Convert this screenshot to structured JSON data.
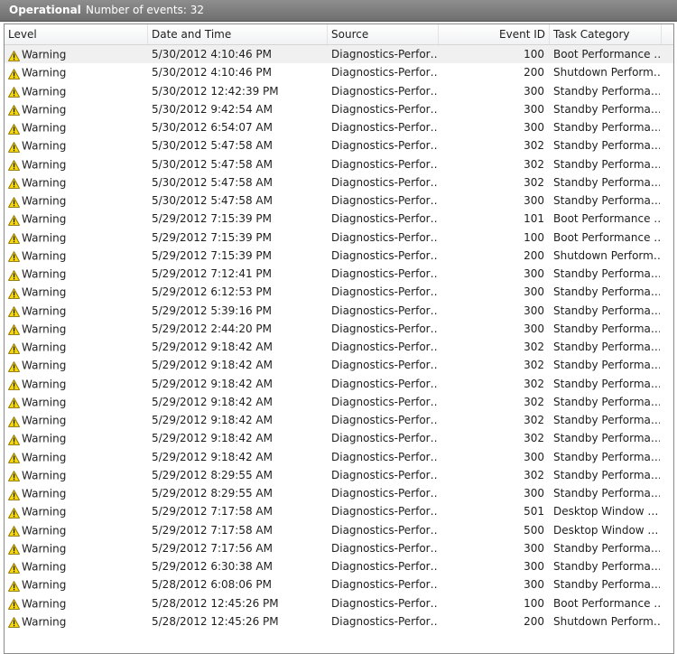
{
  "window": {
    "title": "Operational",
    "event_count_label": "Number of events: 32"
  },
  "columns": {
    "level": "Level",
    "date_time": "Date and Time",
    "source": "Source",
    "event_id": "Event ID",
    "task_category": "Task Category"
  },
  "icons": {
    "level": "warning-icon"
  },
  "colors": {
    "warning_fill": "#f5d90a",
    "warning_stroke": "#8a6d00",
    "titlebar": "#7a7a7a"
  },
  "events": [
    {
      "level": "Warning",
      "date": "5/30/2012 4:10:46 PM",
      "source": "Diagnostics-Perfor…",
      "id": "100",
      "category": "Boot Performance …"
    },
    {
      "level": "Warning",
      "date": "5/30/2012 4:10:46 PM",
      "source": "Diagnostics-Perfor…",
      "id": "200",
      "category": "Shutdown Perform…"
    },
    {
      "level": "Warning",
      "date": "5/30/2012 12:42:39 PM",
      "source": "Diagnostics-Perfor…",
      "id": "300",
      "category": "Standby Performa…"
    },
    {
      "level": "Warning",
      "date": "5/30/2012 9:42:54 AM",
      "source": "Diagnostics-Perfor…",
      "id": "300",
      "category": "Standby Performa…"
    },
    {
      "level": "Warning",
      "date": "5/30/2012 6:54:07 AM",
      "source": "Diagnostics-Perfor…",
      "id": "300",
      "category": "Standby Performa…"
    },
    {
      "level": "Warning",
      "date": "5/30/2012 5:47:58 AM",
      "source": "Diagnostics-Perfor…",
      "id": "302",
      "category": "Standby Performa…"
    },
    {
      "level": "Warning",
      "date": "5/30/2012 5:47:58 AM",
      "source": "Diagnostics-Perfor…",
      "id": "302",
      "category": "Standby Performa…"
    },
    {
      "level": "Warning",
      "date": "5/30/2012 5:47:58 AM",
      "source": "Diagnostics-Perfor…",
      "id": "302",
      "category": "Standby Performa…"
    },
    {
      "level": "Warning",
      "date": "5/30/2012 5:47:58 AM",
      "source": "Diagnostics-Perfor…",
      "id": "300",
      "category": "Standby Performa…"
    },
    {
      "level": "Warning",
      "date": "5/29/2012 7:15:39 PM",
      "source": "Diagnostics-Perfor…",
      "id": "101",
      "category": "Boot Performance …"
    },
    {
      "level": "Warning",
      "date": "5/29/2012 7:15:39 PM",
      "source": "Diagnostics-Perfor…",
      "id": "100",
      "category": "Boot Performance …"
    },
    {
      "level": "Warning",
      "date": "5/29/2012 7:15:39 PM",
      "source": "Diagnostics-Perfor…",
      "id": "200",
      "category": "Shutdown Perform…"
    },
    {
      "level": "Warning",
      "date": "5/29/2012 7:12:41 PM",
      "source": "Diagnostics-Perfor…",
      "id": "300",
      "category": "Standby Performa…"
    },
    {
      "level": "Warning",
      "date": "5/29/2012 6:12:53 PM",
      "source": "Diagnostics-Perfor…",
      "id": "300",
      "category": "Standby Performa…"
    },
    {
      "level": "Warning",
      "date": "5/29/2012 5:39:16 PM",
      "source": "Diagnostics-Perfor…",
      "id": "300",
      "category": "Standby Performa…"
    },
    {
      "level": "Warning",
      "date": "5/29/2012 2:44:20 PM",
      "source": "Diagnostics-Perfor…",
      "id": "300",
      "category": "Standby Performa…"
    },
    {
      "level": "Warning",
      "date": "5/29/2012 9:18:42 AM",
      "source": "Diagnostics-Perfor…",
      "id": "302",
      "category": "Standby Performa…"
    },
    {
      "level": "Warning",
      "date": "5/29/2012 9:18:42 AM",
      "source": "Diagnostics-Perfor…",
      "id": "302",
      "category": "Standby Performa…"
    },
    {
      "level": "Warning",
      "date": "5/29/2012 9:18:42 AM",
      "source": "Diagnostics-Perfor…",
      "id": "302",
      "category": "Standby Performa…"
    },
    {
      "level": "Warning",
      "date": "5/29/2012 9:18:42 AM",
      "source": "Diagnostics-Perfor…",
      "id": "302",
      "category": "Standby Performa…"
    },
    {
      "level": "Warning",
      "date": "5/29/2012 9:18:42 AM",
      "source": "Diagnostics-Perfor…",
      "id": "302",
      "category": "Standby Performa…"
    },
    {
      "level": "Warning",
      "date": "5/29/2012 9:18:42 AM",
      "source": "Diagnostics-Perfor…",
      "id": "302",
      "category": "Standby Performa…"
    },
    {
      "level": "Warning",
      "date": "5/29/2012 9:18:42 AM",
      "source": "Diagnostics-Perfor…",
      "id": "300",
      "category": "Standby Performa…"
    },
    {
      "level": "Warning",
      "date": "5/29/2012 8:29:55 AM",
      "source": "Diagnostics-Perfor…",
      "id": "302",
      "category": "Standby Performa…"
    },
    {
      "level": "Warning",
      "date": "5/29/2012 8:29:55 AM",
      "source": "Diagnostics-Perfor…",
      "id": "300",
      "category": "Standby Performa…"
    },
    {
      "level": "Warning",
      "date": "5/29/2012 7:17:58 AM",
      "source": "Diagnostics-Perfor…",
      "id": "501",
      "category": "Desktop Window …"
    },
    {
      "level": "Warning",
      "date": "5/29/2012 7:17:58 AM",
      "source": "Diagnostics-Perfor…",
      "id": "500",
      "category": "Desktop Window …"
    },
    {
      "level": "Warning",
      "date": "5/29/2012 7:17:56 AM",
      "source": "Diagnostics-Perfor…",
      "id": "300",
      "category": "Standby Performa…"
    },
    {
      "level": "Warning",
      "date": "5/29/2012 6:30:38 AM",
      "source": "Diagnostics-Perfor…",
      "id": "300",
      "category": "Standby Performa…"
    },
    {
      "level": "Warning",
      "date": "5/28/2012 6:08:06 PM",
      "source": "Diagnostics-Perfor…",
      "id": "300",
      "category": "Standby Performa…"
    },
    {
      "level": "Warning",
      "date": "5/28/2012 12:45:26 PM",
      "source": "Diagnostics-Perfor…",
      "id": "100",
      "category": "Boot Performance …"
    },
    {
      "level": "Warning",
      "date": "5/28/2012 12:45:26 PM",
      "source": "Diagnostics-Perfor…",
      "id": "200",
      "category": "Shutdown Perform…"
    }
  ]
}
